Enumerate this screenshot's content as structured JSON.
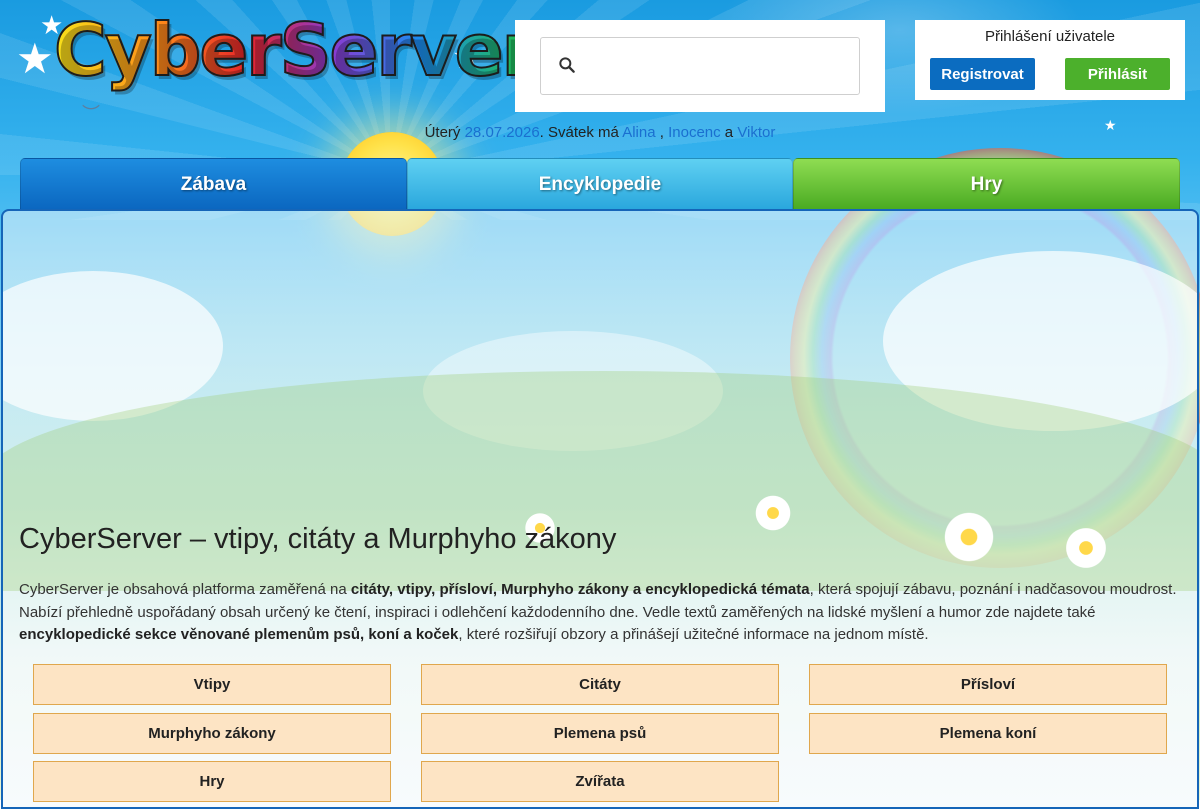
{
  "header": {
    "logo_text": "CyberServer",
    "search": {
      "placeholder": "",
      "value": ""
    },
    "login": {
      "title": "Přihlášení uživatele",
      "register_label": "Registrovat",
      "login_label": "Přihlásit",
      "register_color": "#0b6cc0",
      "login_color": "#4cb02c"
    },
    "date_line": {
      "prefix": "Úterý ",
      "date": "28.07.2026",
      "middle": ". Svátek má ",
      "name1": "Alina",
      "sep1": " , ",
      "name2": "Inocenc",
      "sep2": " a ",
      "name3": "Viktor"
    }
  },
  "tabs": [
    {
      "label": "Zábava",
      "color": "#0b67c0"
    },
    {
      "label": "Encyklopedie",
      "color": "#2aa7dd"
    },
    {
      "label": "Hry",
      "color": "#4aab22"
    }
  ],
  "main": {
    "title": "CyberServer – vtipy, citáty a Murphyho zákony",
    "desc": {
      "p1": "CyberServer je obsahová platforma zaměřená na ",
      "b1": "citáty, vtipy, přísloví, Murphyho zákony a encyklopedická témata",
      "p2": ", která spojují zábavu, poznání i nadčasovou moudrost. Nabízí přehledně uspořádaný obsah určený ke čtení, inspiraci i odlehčení každodenního dne. Vedle textů zaměřených na lidské myšlení a humor zde najdete také ",
      "b2": "encyklopedické sekce věnované plemenům psů, koní a koček",
      "p3": ", které rozšiřují obzory a přinášejí užitečné informace na jednom místě."
    },
    "categories": [
      "Vtipy",
      "Citáty",
      "Přísloví",
      "Murphyho zákony",
      "Plemena psů",
      "Plemena koní",
      "Hry",
      "Zvířata"
    ]
  }
}
